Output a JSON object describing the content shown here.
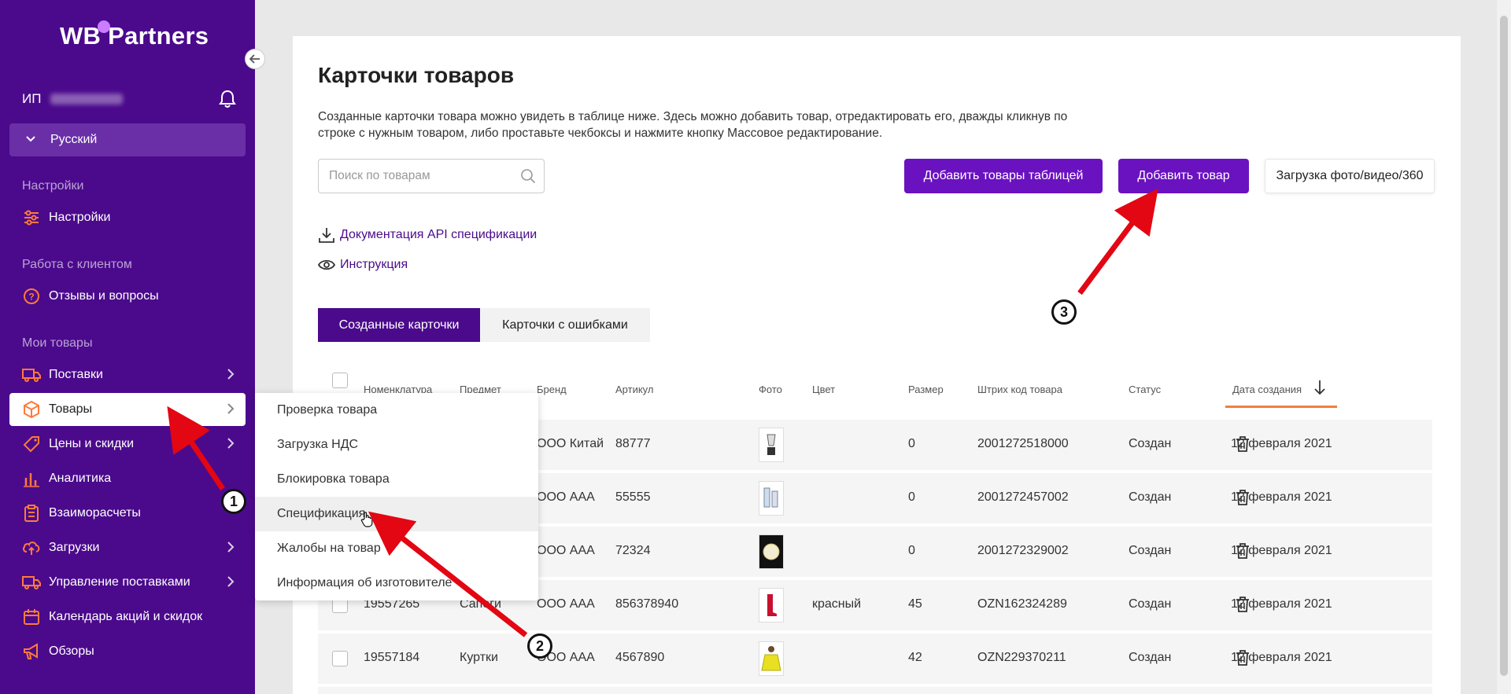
{
  "sidebar": {
    "logo": "WB Partners",
    "user_prefix": "ИП",
    "language": "Русский",
    "sections": [
      {
        "title": "Настройки",
        "items": [
          {
            "label": "Настройки",
            "icon": "sliders-icon"
          }
        ]
      },
      {
        "title": "Работа с клиентом",
        "items": [
          {
            "label": "Отзывы и вопросы",
            "icon": "question-icon"
          }
        ]
      },
      {
        "title": "Мои товары",
        "items": [
          {
            "label": "Поставки",
            "icon": "truck-icon",
            "arrow": true
          },
          {
            "label": "Товары",
            "icon": "box-icon",
            "arrow": true,
            "active": true
          },
          {
            "label": "Цены и скидки",
            "icon": "tag-icon",
            "arrow": true
          },
          {
            "label": "Аналитика",
            "icon": "chart-icon",
            "arrow": false
          },
          {
            "label": "Взаиморасчеты",
            "icon": "clipboard-icon",
            "arrow": false
          },
          {
            "label": "Загрузки",
            "icon": "upload-cloud-icon",
            "arrow": true
          },
          {
            "label": "Управление поставками",
            "icon": "truck-icon",
            "arrow": true
          },
          {
            "label": "Календарь акций и скидок",
            "icon": "calendar-icon",
            "arrow": false
          },
          {
            "label": "Обзоры",
            "icon": "megaphone-icon",
            "arrow": false
          }
        ]
      }
    ]
  },
  "submenu": {
    "items": [
      "Проверка товара",
      "Загрузка НДС",
      "Блокировка товара",
      "Спецификация",
      "Жалобы на товар",
      "Информация об изготовителе"
    ],
    "hovered_index": 3
  },
  "main": {
    "title": "Карточки товаров",
    "description": "Созданные карточки товара можно увидеть в таблице ниже. Здесь можно добавить товар, отредактировать его, дважды кликнув по строке с нужным товаром, либо проставьте чекбоксы и нажмите кнопку Массовое редактирование.",
    "search_placeholder": "Поиск по товарам",
    "buttons": {
      "add_table": "Добавить товары таблицей",
      "add_item": "Добавить товар",
      "upload_media": "Загрузка фото/видео/360"
    },
    "links": {
      "api_doc": "Документация API спецификации",
      "instruction": "Инструкция"
    },
    "tabs": [
      "Созданные карточки",
      "Карточки с ошибками"
    ],
    "table": {
      "headers": [
        "Номенклатура",
        "Предмет",
        "Бренд",
        "Артикул",
        "Фото",
        "Цвет",
        "Размер",
        "Штрих код товара",
        "Статус",
        "Дата создания"
      ],
      "rows": [
        {
          "nm": "",
          "subject": "",
          "brand": "ООО Китай",
          "article": "88777",
          "photo": "blender-photo",
          "color": "",
          "size": "0",
          "barcode": "2001272518000",
          "status": "Создан",
          "date": "12 февраля 2021"
        },
        {
          "nm": "",
          "subject": "",
          "brand": "ООО ААА",
          "article": "55555",
          "photo": "bottles-photo",
          "color": "",
          "size": "0",
          "barcode": "2001272457002",
          "status": "Создан",
          "date": "12 февраля 2021"
        },
        {
          "nm": "",
          "subject": "",
          "brand": "ООО ААА",
          "article": "72324",
          "photo": "plate-photo",
          "color": "",
          "size": "0",
          "barcode": "2001272329002",
          "status": "Создан",
          "date": "12 февраля 2021"
        },
        {
          "nm": "19557265",
          "subject": "Сапоги",
          "brand": "ООО ААА",
          "article": "856378940",
          "photo": "boots-photo",
          "color": "красный",
          "size": "45",
          "barcode": "OZN162324289",
          "status": "Создан",
          "date": "12 февраля 2021"
        },
        {
          "nm": "19557184",
          "subject": "Куртки",
          "brand": "ООО ААА",
          "article": "4567890",
          "photo": "jacket-photo",
          "color": "",
          "size": "42",
          "barcode": "OZN229370211",
          "status": "Создан",
          "date": "12 февраля 2021"
        }
      ]
    }
  },
  "annotations": [
    "1",
    "2",
    "3"
  ]
}
